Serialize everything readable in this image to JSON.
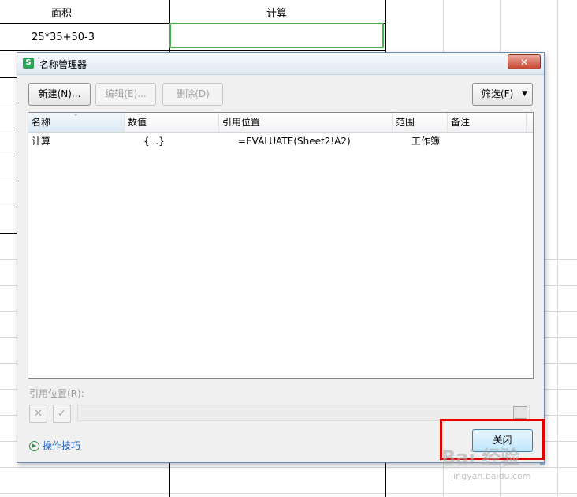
{
  "sheet": {
    "cell_area_header": "面积",
    "cell_calc_header": "计算",
    "cell_area_value": "25*35+50-3"
  },
  "dialog": {
    "app_icon": "S",
    "title": "名称管理器",
    "close_icon": "x-icon",
    "buttons": {
      "new": "新建(N)...",
      "edit": "编辑(E)...",
      "delete": "删除(D)",
      "filter": "筛选(F)"
    },
    "columns": [
      "名称",
      "数值",
      "引用位置",
      "范围",
      "备注"
    ],
    "rows": [
      {
        "name": "计算",
        "value": "{...}",
        "refers_to": "=EVALUATE(Sheet2!A2)",
        "scope": "工作簿",
        "comment": ""
      }
    ],
    "ref_label": "引用位置(R):",
    "cancel_icon": "✕",
    "confirm_icon": "✓",
    "tips": "操作技巧",
    "close_button": "关闭"
  },
  "watermark": {
    "text": "Bai 经验",
    "sub": "jingyan.baidu.com"
  },
  "colors": {
    "selection": "#4caf50",
    "highlight": "#e00000",
    "link": "#1f5fbf"
  }
}
